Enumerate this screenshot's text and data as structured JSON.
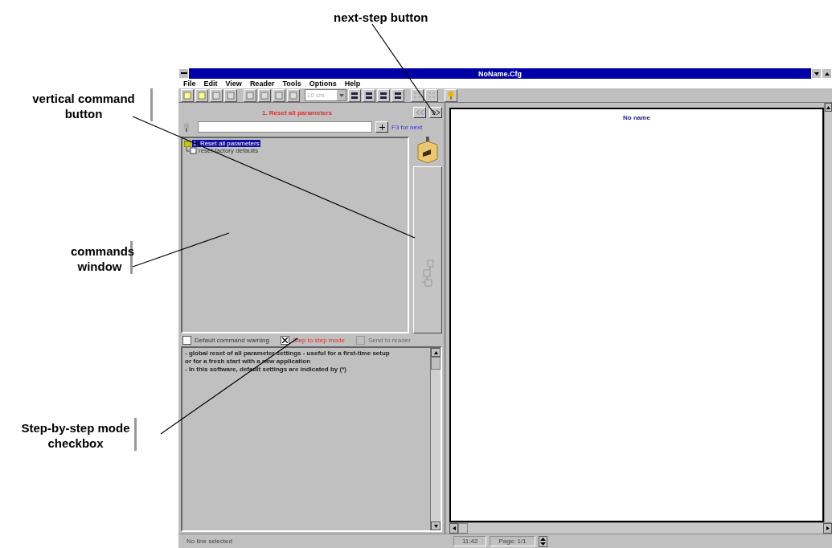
{
  "callouts": [
    {
      "text": "next-step button",
      "kind": "top"
    },
    {
      "text": "vertical command button",
      "kind": "left"
    },
    {
      "text": "commands window",
      "kind": "left"
    },
    {
      "text": "Step-by-step mode checkbox",
      "kind": "left"
    }
  ],
  "window": {
    "title": "NoName.Cfg"
  },
  "menu": [
    "File",
    "Edit",
    "View",
    "Reader",
    "Tools",
    "Options",
    "Help"
  ],
  "toolbar": {
    "unit": "10 cm"
  },
  "commands_panel": {
    "step_title": "1. Reset all parameters",
    "hint": "F3 for next",
    "tree": [
      {
        "label": "1. Reset all parameters",
        "selected": true,
        "children": [
          {
            "label": "reset factory defaults",
            "checked": false,
            "selected": false
          }
        ]
      }
    ]
  },
  "options": [
    {
      "label": "Default command warning",
      "checked": false,
      "disabled": false
    },
    {
      "label": "Step to step mode",
      "checked": true,
      "disabled": false
    },
    {
      "label": "Send to reader",
      "checked": false,
      "disabled": true
    }
  ],
  "description": [
    "- global reset of all parameter settings - useful for a first-time setup",
    "or for a fresh start with a new application",
    "- In this software, default settings are indicated by (*)"
  ],
  "document": {
    "title": "No name"
  },
  "status_bar": {
    "message": "No line selected",
    "time": "11:42",
    "page": "Page: 1/1"
  }
}
